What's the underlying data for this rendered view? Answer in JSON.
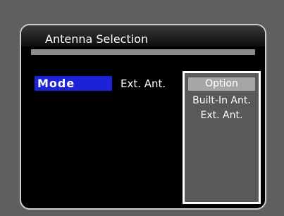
{
  "window": {
    "title": "Antenna Selection"
  },
  "settings": {
    "mode_label": "Mode",
    "mode_value": "Ext. Ant."
  },
  "options": {
    "header": "Option",
    "items": [
      "Built-In Ant.",
      "Ext. Ant."
    ]
  },
  "colors": {
    "background": "#5f5f5f",
    "panel": "#000000",
    "highlight": "#1c22d6",
    "option_box": "#595959",
    "option_header": "#a6a6a6"
  }
}
